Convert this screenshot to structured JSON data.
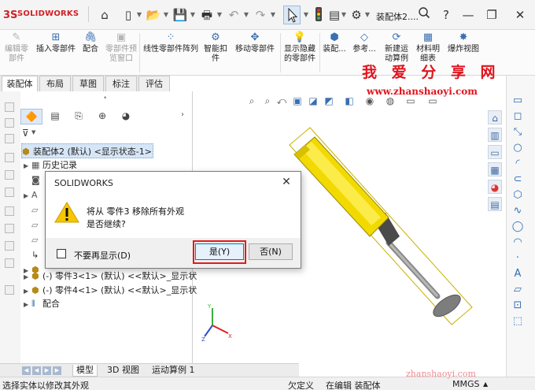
{
  "app": {
    "logo_text": "SOLIDWORKS",
    "doc_title": "装配体2....",
    "brand_color": "#d22027"
  },
  "ribbon": {
    "items": [
      {
        "label1": "编辑零",
        "label2": "部件",
        "icon": "edit-component-icon",
        "disabled": true
      },
      {
        "label1": "插入零部件",
        "label2": "",
        "icon": "insert-components-icon",
        "disabled": false
      },
      {
        "label1": "配合",
        "label2": "",
        "icon": "mate-icon",
        "disabled": false
      },
      {
        "label1": "零部件预",
        "label2": "览窗口",
        "icon": "component-preview-icon",
        "disabled": true
      },
      {
        "label1": "线性零部件阵列",
        "label2": "",
        "icon": "linear-pattern-icon",
        "disabled": false
      },
      {
        "label1": "智能扣",
        "label2": "件",
        "icon": "smart-fasteners-icon",
        "disabled": false
      },
      {
        "label1": "移动零部件",
        "label2": "",
        "icon": "move-component-icon",
        "disabled": false
      },
      {
        "label1": "显示隐藏",
        "label2": "的零部件",
        "icon": "show-hidden-icon",
        "disabled": false
      },
      {
        "label1": "装配...",
        "label2": "",
        "icon": "assembly-features-icon",
        "disabled": false
      },
      {
        "label1": "参考...",
        "label2": "",
        "icon": "reference-geometry-icon",
        "disabled": false
      },
      {
        "label1": "新建运",
        "label2": "动算例",
        "icon": "new-motion-study-icon",
        "disabled": false
      },
      {
        "label1": "材料明",
        "label2": "细表",
        "icon": "bom-icon",
        "disabled": false
      },
      {
        "label1": "爆炸视图",
        "label2": "",
        "icon": "exploded-view-icon",
        "disabled": false
      }
    ]
  },
  "watermark": {
    "title": "我 爱 分 享 网",
    "url": "www.zhanshaoyi.com",
    "footer": "zhanshaoyi.com"
  },
  "tabs": [
    "装配体",
    "布局",
    "草图",
    "标注",
    "评估"
  ],
  "feature_tree": {
    "root": "装配体2 (默认) <显示状态-1>",
    "rows": [
      {
        "label": "历史记录",
        "icon": "history-icon"
      },
      {
        "label": "",
        "icon": "sensors-icon"
      },
      {
        "label": "",
        "icon": "annotations-icon"
      },
      {
        "label": "",
        "icon": "front-plane-icon"
      },
      {
        "label": "",
        "icon": "top-plane-icon"
      },
      {
        "label": "",
        "icon": "right-plane-icon"
      },
      {
        "label": "",
        "icon": "origin-icon"
      },
      {
        "label": "",
        "icon": "part-icon"
      },
      {
        "label": "(-) 零件3<1> (默认) <<默认>_显示状",
        "icon": "part-icon"
      },
      {
        "label": "(-) 零件4<1> (默认) <<默认>_显示状",
        "icon": "part-icon"
      },
      {
        "label": "配合",
        "icon": "mates-folder-icon"
      }
    ]
  },
  "dialog": {
    "title": "SOLIDWORKS",
    "message_line1": "将从 零件3 移除所有外观",
    "message_line2": "是否继续?",
    "checkbox_label": "不要再显示(D)",
    "yes_label": "是(Y)",
    "no_label": "否(N)"
  },
  "bottom_tabs": [
    "模型",
    "3D 视图",
    "运动算例 1"
  ],
  "status_bar": {
    "hint": "选择实体以修改其外观",
    "state": "欠定义",
    "mode": "在编辑 装配体",
    "units": "MMGS"
  }
}
